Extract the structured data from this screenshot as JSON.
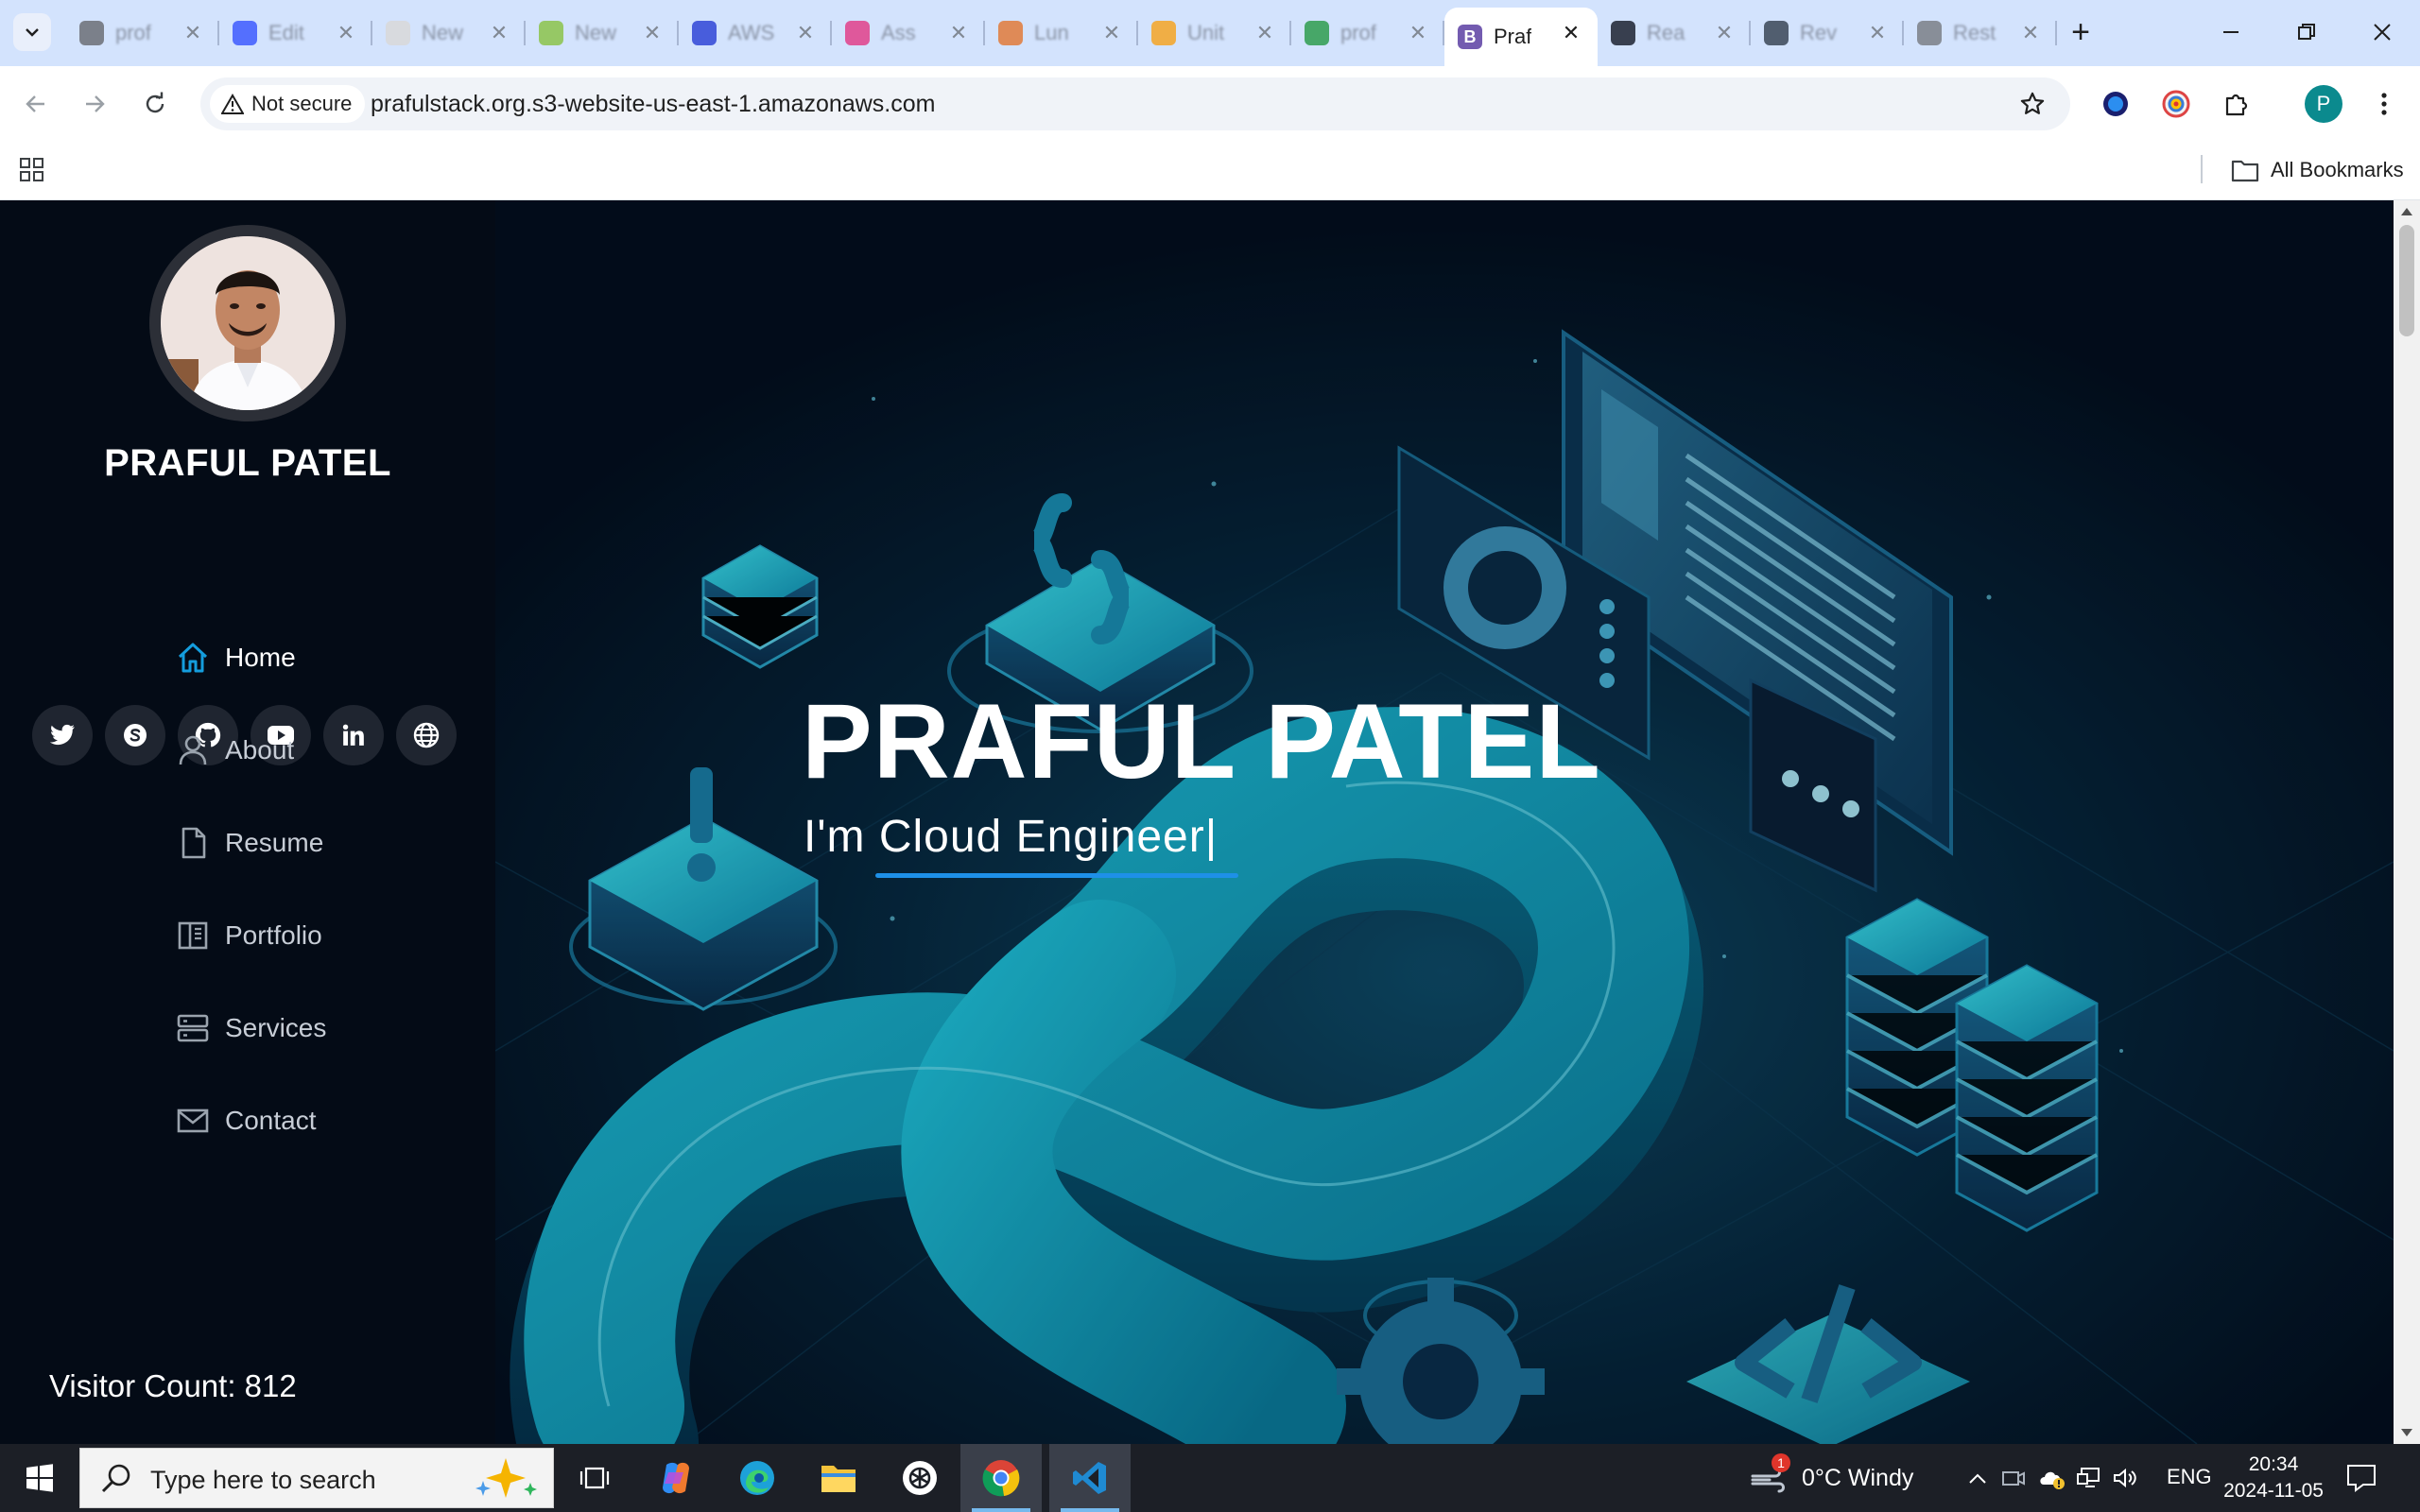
{
  "browser": {
    "tabs": [
      {
        "title": "prof",
        "favicon_color": "#6b6f76"
      },
      {
        "title": "Edit",
        "favicon_color": "#3d5afe"
      },
      {
        "title": "New",
        "favicon_color": "#d8d8d8"
      },
      {
        "title": "New",
        "favicon_color": "#8bc34a"
      },
      {
        "title": "AWS",
        "favicon_color": "#2f45d6"
      },
      {
        "title": "Ass",
        "favicon_color": "#e0408a"
      },
      {
        "title": "Lun",
        "favicon_color": "#e07a3a"
      },
      {
        "title": "Unit",
        "favicon_color": "#f5a524"
      },
      {
        "title": "prof",
        "favicon_color": "#2e9c4d"
      },
      {
        "title": "Praf",
        "favicon_color": "#5b3fa3",
        "favicon_letter": "B",
        "active": true
      },
      {
        "title": "Rea",
        "favicon_color": "#1c2230",
        "favicon_icon": "react-icon"
      },
      {
        "title": "Rev",
        "favicon_color": "#3a4656"
      },
      {
        "title": "Rest",
        "favicon_color": "#7a7f86"
      }
    ],
    "address": {
      "security_label": "Not secure",
      "url": "prafulstack.org.s3-website-us-east-1.amazonaws.com"
    },
    "profile_initial": "P",
    "bookmarks": {
      "all_label": "All Bookmarks"
    }
  },
  "site": {
    "sidebar": {
      "name": "PRAFUL PATEL",
      "social": [
        "twitter-icon",
        "skype-icon",
        "github-icon",
        "youtube-icon",
        "linkedin-icon",
        "globe-icon"
      ],
      "menu": [
        {
          "label": "Home",
          "icon": "home-icon",
          "active": true
        },
        {
          "label": "About",
          "icon": "person-icon"
        },
        {
          "label": "Resume",
          "icon": "file-icon"
        },
        {
          "label": "Portfolio",
          "icon": "book-icon"
        },
        {
          "label": "Services",
          "icon": "server-icon"
        },
        {
          "label": "Contact",
          "icon": "envelope-icon"
        }
      ],
      "visitor_count": "Visitor Count: 812"
    },
    "hero": {
      "title": "PRAFUL PATEL",
      "subtitle": "I'm Cloud Engineer|",
      "accent_color": "#1e90e8"
    }
  },
  "taskbar": {
    "search_placeholder": "Type here to search",
    "weather": {
      "text": "0°C  Windy",
      "badge": "1"
    },
    "language": "ENG",
    "time": "20:34",
    "date": "2024-11-05"
  }
}
